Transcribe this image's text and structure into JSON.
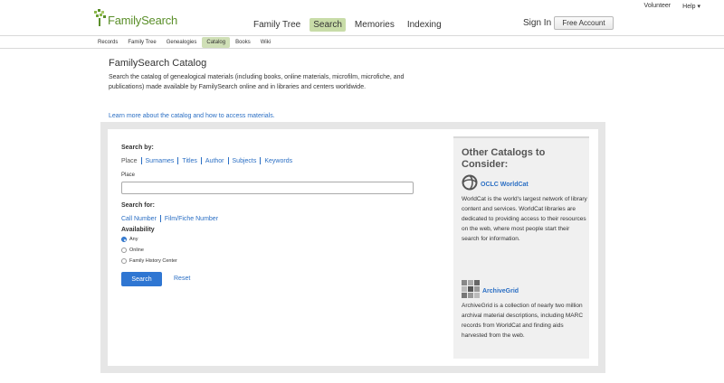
{
  "utility": {
    "volunteer": "Volunteer",
    "help": "Help ▾"
  },
  "brand": {
    "name": "FamilySearch",
    "color": "#5b8f2a"
  },
  "main_nav": [
    {
      "label": "Family Tree",
      "active": false
    },
    {
      "label": "Search",
      "active": true
    },
    {
      "label": "Memories",
      "active": false
    },
    {
      "label": "Indexing",
      "active": false
    }
  ],
  "account": {
    "sign_in": "Sign In",
    "free_account": "Free Account"
  },
  "sub_nav": [
    {
      "label": "Records",
      "active": false
    },
    {
      "label": "Family Tree",
      "active": false
    },
    {
      "label": "Genealogies",
      "active": false
    },
    {
      "label": "Catalog",
      "active": true
    },
    {
      "label": "Books",
      "active": false
    },
    {
      "label": "Wiki",
      "active": false
    }
  ],
  "page": {
    "title": "FamilySearch Catalog",
    "description": "Search the catalog of genealogical materials (including books, online materials, microfilm, microfiche, and publications) made available by FamilySearch online and in libraries and centers worldwide.",
    "learn_link": "Learn more about the catalog and how to access materials."
  },
  "search": {
    "search_by_label": "Search by:",
    "search_by_tabs": [
      "Place",
      "Surnames",
      "Titles",
      "Author",
      "Subjects",
      "Keywords"
    ],
    "selected_tab": "Place",
    "field_label": "Place",
    "field_value": "",
    "search_for_label": "Search for:",
    "search_for_links": [
      "Call Number",
      "Film/Fiche Number"
    ],
    "availability_label": "Availability",
    "availability_options": [
      {
        "label": "Any",
        "checked": true
      },
      {
        "label": "Online",
        "checked": false
      },
      {
        "label": "Family History Center",
        "checked": false
      }
    ],
    "search_button": "Search",
    "reset_link": "Reset",
    "accent_color": "#2f76d2"
  },
  "sidebar": {
    "title": "Other Catalogs to Consider:",
    "catalogs": [
      {
        "name": "OCLC WorldCat",
        "icon": "worldcat-logo-icon",
        "text": "WorldCat is the world's largest network of library content and services. WorldCat libraries are dedicated to providing access to their resources on the web, where most people start their search for information."
      },
      {
        "name": "ArchiveGrid",
        "icon": "archivegrid-logo-icon",
        "text": "ArchiveGrid is a collection of nearly two million archival material descriptions, including MARC records from WorldCat and finding aids harvested from the web."
      }
    ]
  }
}
